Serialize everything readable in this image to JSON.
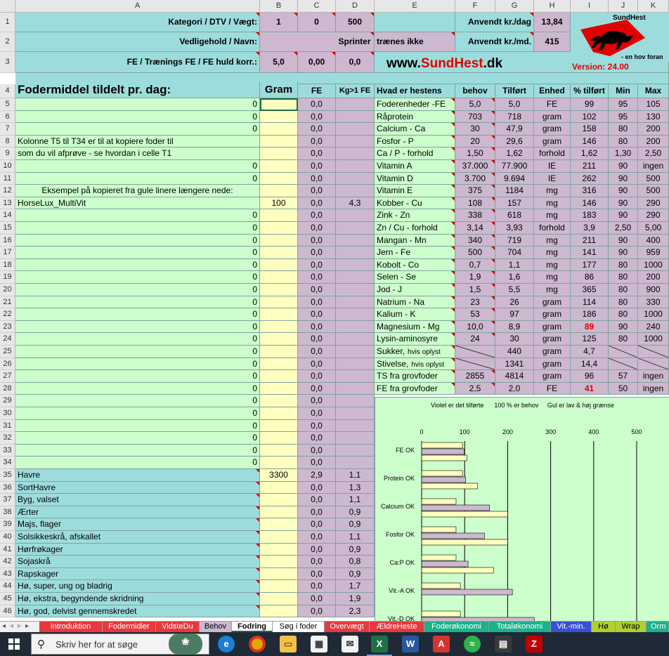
{
  "columns": [
    "A",
    "B",
    "C",
    "D",
    "E",
    "F",
    "G",
    "H",
    "I",
    "J",
    "K"
  ],
  "rows_top": {
    "r1": {
      "label": "Kategori / DTV / Vægt:",
      "b": "1",
      "c": "0",
      "d": "500",
      "e": "Anvendt kr./dag",
      "h": "13,84"
    },
    "r2": {
      "label": "Vedligehold / Navn:",
      "bcd": "Sprinter",
      "e_extra": "trænes ikke",
      "e": "Anvendt kr./md.",
      "h": "415"
    },
    "r3": {
      "label": "FE / Trænings FE / FE huld korr.:",
      "b": "5,0",
      "c": "0,00",
      "d": "0,0",
      "website_prefix": "www.",
      "website_brand": "SundHest",
      "website_suffix": ".dk",
      "version": "Version: 24.00"
    },
    "logo": {
      "brand": "SundHest",
      "tagline": "- en hov foran"
    }
  },
  "headers": {
    "a": "Fodermiddel tildelt pr. dag:",
    "b": "Gram",
    "c": "FE",
    "d": "Kg>1 FE",
    "e": "Hvad er hestens",
    "f": "behov",
    "g": "Tilført",
    "h": "Enhed",
    "i": "% tilført",
    "j": "Min",
    "k": "Max"
  },
  "feed_rows": [
    {
      "row": "5",
      "a": "0",
      "b": "",
      "c": "0,0",
      "d": ""
    },
    {
      "row": "6",
      "a": "0",
      "b": "",
      "c": "0,0",
      "d": ""
    },
    {
      "row": "7",
      "a": "0",
      "b": "",
      "c": "0,0",
      "d": ""
    },
    {
      "row": "8",
      "a": "Kolonne T5 til T34 er til at kopiere foder til",
      "b": "",
      "c": "0,0",
      "d": ""
    },
    {
      "row": "9",
      "a": "som du vil afprøve - se hvordan i celle T1",
      "b": "",
      "c": "0,0",
      "d": ""
    },
    {
      "row": "10",
      "a": "0",
      "b": "",
      "c": "0,0",
      "d": ""
    },
    {
      "row": "11",
      "a": "0",
      "b": "",
      "c": "0,0",
      "d": ""
    },
    {
      "row": "12",
      "a": "Eksempel på kopieret fra gule linere længere nede:",
      "b": "",
      "c": "0,0",
      "d": ""
    },
    {
      "row": "13",
      "a": "HorseLux_MultiVit",
      "b": "100",
      "c": "0,0",
      "d": "4,3"
    },
    {
      "row": "14",
      "a": "0",
      "b": "",
      "c": "0,0",
      "d": ""
    },
    {
      "row": "15",
      "a": "0",
      "b": "",
      "c": "0,0",
      "d": ""
    },
    {
      "row": "16",
      "a": "0",
      "b": "",
      "c": "0,0",
      "d": ""
    },
    {
      "row": "17",
      "a": "0",
      "b": "",
      "c": "0,0",
      "d": ""
    },
    {
      "row": "18",
      "a": "0",
      "b": "",
      "c": "0,0",
      "d": ""
    },
    {
      "row": "19",
      "a": "0",
      "b": "",
      "c": "0,0",
      "d": ""
    },
    {
      "row": "20",
      "a": "0",
      "b": "",
      "c": "0,0",
      "d": ""
    },
    {
      "row": "21",
      "a": "0",
      "b": "",
      "c": "0,0",
      "d": ""
    },
    {
      "row": "22",
      "a": "0",
      "b": "",
      "c": "0,0",
      "d": ""
    },
    {
      "row": "23",
      "a": "0",
      "b": "",
      "c": "0,0",
      "d": ""
    },
    {
      "row": "24",
      "a": "0",
      "b": "",
      "c": "0,0",
      "d": ""
    },
    {
      "row": "25",
      "a": "0",
      "b": "",
      "c": "0,0",
      "d": ""
    },
    {
      "row": "26",
      "a": "0",
      "b": "",
      "c": "0,0",
      "d": ""
    },
    {
      "row": "27",
      "a": "0",
      "b": "",
      "c": "0,0",
      "d": ""
    },
    {
      "row": "28",
      "a": "0",
      "b": "",
      "c": "0,0",
      "d": ""
    },
    {
      "row": "29",
      "a": "0",
      "b": "",
      "c": "0,0",
      "d": ""
    },
    {
      "row": "30",
      "a": "0",
      "b": "",
      "c": "0,0",
      "d": ""
    },
    {
      "row": "31",
      "a": "0",
      "b": "",
      "c": "0,0",
      "d": ""
    },
    {
      "row": "32",
      "a": "0",
      "b": "",
      "c": "0,0",
      "d": ""
    },
    {
      "row": "33",
      "a": "0",
      "b": "",
      "c": "0,0",
      "d": ""
    },
    {
      "row": "34",
      "a": "0",
      "b": "",
      "c": "0,0",
      "d": ""
    },
    {
      "row": "35",
      "a": "Havre",
      "b": "3300",
      "c": "2,9",
      "d": "1,1"
    },
    {
      "row": "36",
      "a": "SortHavre",
      "b": "",
      "c": "0,0",
      "d": "1,3"
    },
    {
      "row": "37",
      "a": "Byg, valset",
      "b": "",
      "c": "0,0",
      "d": "1,1"
    },
    {
      "row": "38",
      "a": "Ærter",
      "b": "",
      "c": "0,0",
      "d": "0,9"
    },
    {
      "row": "39",
      "a": "Majs, flager",
      "b": "",
      "c": "0,0",
      "d": "0,9"
    },
    {
      "row": "40",
      "a": "Solsikkeskrå, afskallet",
      "b": "",
      "c": "0,0",
      "d": "1,1"
    },
    {
      "row": "41",
      "a": "Hørfrøkager",
      "b": "",
      "c": "0,0",
      "d": "0,9"
    },
    {
      "row": "42",
      "a": "Sojaskrå",
      "b": "",
      "c": "0,0",
      "d": "0,8"
    },
    {
      "row": "43",
      "a": "Rapskager",
      "b": "",
      "c": "0,0",
      "d": "0,9"
    },
    {
      "row": "44",
      "a": "Hø, super, ung og bladrig",
      "b": "",
      "c": "0,0",
      "d": "1,7"
    },
    {
      "row": "45",
      "a": "Hø, ekstra, begyndende skridning",
      "b": "",
      "c": "0,0",
      "d": "1,9"
    },
    {
      "row": "46",
      "a": "Hø, god, delvist gennemskredet",
      "b": "",
      "c": "0,0",
      "d": "2,3"
    }
  ],
  "nutrients": [
    {
      "e": "Foderenheder -FE",
      "f": "5,0",
      "g": "5,0",
      "h": "FE",
      "i": "99",
      "j": "95",
      "k": "105"
    },
    {
      "e": "Råprotein",
      "f": "703",
      "g": "718",
      "h": "gram",
      "i": "102",
      "j": "95",
      "k": "130"
    },
    {
      "e": "Calcium - Ca",
      "f": "30",
      "g": "47,9",
      "h": "gram",
      "i": "158",
      "j": "80",
      "k": "200"
    },
    {
      "e": "Fosfor - P",
      "f": "20",
      "g": "29,6",
      "h": "gram",
      "i": "146",
      "j": "80",
      "k": "200"
    },
    {
      "e": "Ca / P - forhold",
      "f": "1,50",
      "g": "1,62",
      "h": "forhold",
      "i": "1,62",
      "j": "1,30",
      "k": "2,50"
    },
    {
      "e": "Vitamin A",
      "f": "37.000",
      "g": "77.900",
      "h": "IE",
      "i": "211",
      "j": "90",
      "k": "ingen"
    },
    {
      "e": "Vitamin D",
      "f": "3.700",
      "g": "9.694",
      "h": "IE",
      "i": "262",
      "j": "90",
      "k": "500"
    },
    {
      "e": "Vitamin E",
      "f": "375",
      "g": "1184",
      "h": "mg",
      "i": "316",
      "j": "90",
      "k": "500"
    },
    {
      "e": "Kobber - Cu",
      "f": "108",
      "g": "157",
      "h": "mg",
      "i": "146",
      "j": "90",
      "k": "290"
    },
    {
      "e": "Zink - Zn",
      "f": "338",
      "g": "618",
      "h": "mg",
      "i": "183",
      "j": "90",
      "k": "290"
    },
    {
      "e": "Zn / Cu - forhold",
      "f": "3,14",
      "g": "3,93",
      "h": "forhold",
      "i": "3,9",
      "j": "2,50",
      "k": "5,00"
    },
    {
      "e": "Mangan - Mn",
      "f": "340",
      "g": "719",
      "h": "mg",
      "i": "211",
      "j": "90",
      "k": "400"
    },
    {
      "e": "Jern - Fe",
      "f": "500",
      "g": "704",
      "h": "mg",
      "i": "141",
      "j": "90",
      "k": "959"
    },
    {
      "e": "Kobolt  - Co",
      "f": "0,7",
      "g": "1,1",
      "h": "mg",
      "i": "177",
      "j": "80",
      "k": "1000"
    },
    {
      "e": "Selen - Se",
      "f": "1,9",
      "g": "1,6",
      "h": "mg",
      "i": "86",
      "j": "80",
      "k": "200"
    },
    {
      "e": "Jod - J",
      "f": "1,5",
      "g": "5,5",
      "h": "mg",
      "i": "365",
      "j": "80",
      "k": "900"
    },
    {
      "e": "Natrium - Na",
      "f": "23",
      "g": "26",
      "h": "gram",
      "i": "114",
      "j": "80",
      "k": "330"
    },
    {
      "e": "Kalium - K",
      "f": "53",
      "g": "97",
      "h": "gram",
      "i": "186",
      "j": "80",
      "k": "1000"
    },
    {
      "e": "Magnesium - Mg",
      "f": "10,0",
      "g": "8,9",
      "h": "gram",
      "i": "89",
      "j": "90",
      "k": "240",
      "i_red": true
    },
    {
      "e": "Lysin-aminosyre",
      "f": "24",
      "g": "30",
      "h": "gram",
      "i": "125",
      "j": "80",
      "k": "1000"
    },
    {
      "e": "Sukker,",
      "e_small": "hvis oplyst",
      "f": "",
      "g": "440",
      "h": "gram",
      "i": "4,7",
      "j": "",
      "k": "",
      "slash": true
    },
    {
      "e": "Stivelse,",
      "e_small": "hvis oplyst",
      "f": "",
      "g": "1341",
      "h": "gram",
      "i": "14,4",
      "j": "",
      "k": "",
      "slash": true
    },
    {
      "e": "TS fra grovfoder",
      "f": "2855",
      "g": "4814",
      "h": "gram",
      "i": "96",
      "j": "57",
      "k": "ingen"
    },
    {
      "e": "FE fra grovfoder",
      "f": "2,5",
      "g": "2,0",
      "h": "FE",
      "i": "41",
      "j": "50",
      "k": "ingen",
      "i_red": true
    }
  ],
  "chart_data": {
    "type": "bar",
    "title": "Violet er det tilførte      100 % er behov     Gul er lav & høj grænse",
    "xlim": [
      0,
      500
    ],
    "xticks": [
      "0",
      "100",
      "200",
      "300",
      "400",
      "500"
    ],
    "categories": [
      "FE  OK",
      "Protein  OK",
      "Calcium  OK",
      "Fosfor OK",
      "Ca:P  OK",
      "Vit.-A  OK",
      "Vit.-D  OK"
    ],
    "series": [
      {
        "values": [
          95,
          95,
          80,
          80,
          80,
          90,
          90
        ]
      },
      {
        "values": [
          99,
          102,
          158,
          146,
          108,
          211,
          262
        ]
      },
      {
        "values": [
          105,
          130,
          200,
          200,
          167,
          null,
          null
        ]
      }
    ],
    "colors": {
      "min": "#ffffc0",
      "tilfort": "#cdb8d0",
      "max": "#ffffc0",
      "background": "#ccffcc",
      "grid": "#000000"
    }
  },
  "sheet_tabs": [
    {
      "label": "Introduktion",
      "color": "#e8383d"
    },
    {
      "label": "Fodermidler",
      "color": "#e8383d"
    },
    {
      "label": "VidsteDu",
      "color": "#e8383d"
    },
    {
      "label": "Behov",
      "color": "#cdb8d0"
    },
    {
      "label": "Fodring",
      "color": "#ffffff",
      "active": true
    },
    {
      "label": "Søg i foder",
      "color": "#ffffff"
    },
    {
      "label": "Overvægt",
      "color": "#e8383d"
    },
    {
      "label": "ÆldreHeste",
      "color": "#e8383d"
    },
    {
      "label": "Foderøkonomi",
      "color": "#1ab28a"
    },
    {
      "label": "Totaløkonomi",
      "color": "#1ab28a"
    },
    {
      "label": "Vit.-min.",
      "color": "#3a4fd6"
    },
    {
      "label": "Hø",
      "color": "#b0d030"
    },
    {
      "label": "Wrap",
      "color": "#b0d030"
    },
    {
      "label": "Orm",
      "color": "#1ab28a"
    }
  ],
  "taskbar": {
    "search_placeholder": "Skriv her for at søge",
    "apps": [
      "start-icon",
      "flower-icon",
      "edge-icon",
      "chrome-icon",
      "explorer-icon",
      "store-icon",
      "mail-icon",
      "excel-icon",
      "word-icon",
      "acrobat-icon",
      "spotify-icon",
      "calculator-icon",
      "filezilla-icon"
    ]
  }
}
